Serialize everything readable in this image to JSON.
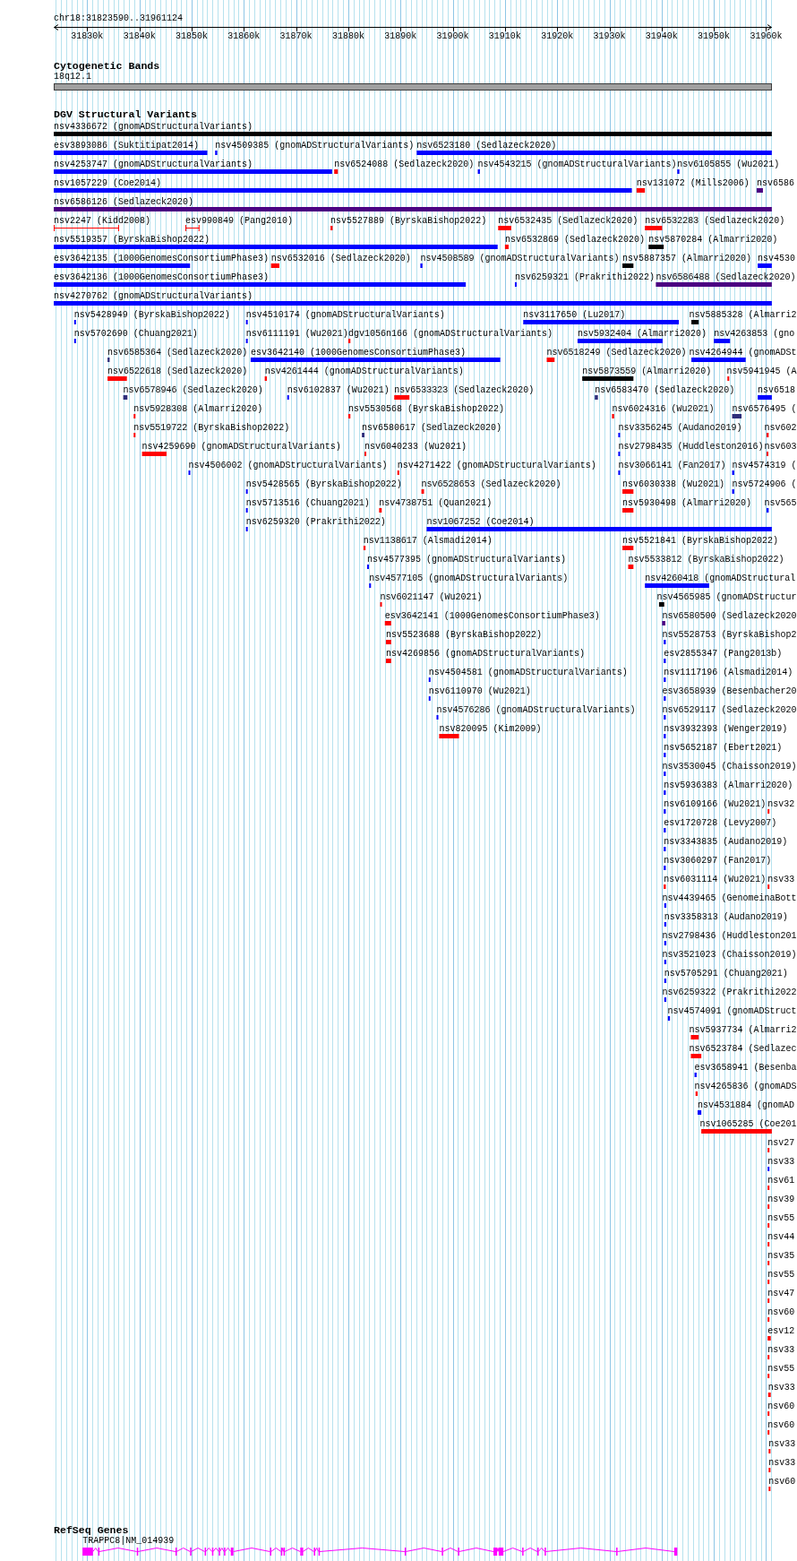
{
  "ruler": {
    "location": "chr18:31823590..31961124",
    "ticks": [
      "31830k",
      "31840k",
      "31850k",
      "31860k",
      "31870k",
      "31880k",
      "31890k",
      "31900k",
      "31910k",
      "31920k",
      "31930k",
      "31940k",
      "31950k",
      "31960k"
    ]
  },
  "cytogenetic_bands": {
    "title": "Cytogenetic Bands",
    "bands": [
      {
        "name": "18q12.1"
      }
    ]
  },
  "dgv_structural_variants": {
    "title": "DGV Structural Variants",
    "rows": [
      [
        {
          "label": "nsv4336672 (gnomADStructuralVariants)",
          "color": "#000000",
          "kind": "bar"
        }
      ],
      [
        {
          "label": "esv3893086 (Suktitipat2014)",
          "color": "#0000ff",
          "kind": "bar"
        },
        {
          "label": "nsv4509385 (gnomADStructuralVariants)",
          "color": "#0000ff",
          "kind": "bar"
        },
        {
          "label": "nsv6523180 (Sedlazeck2020)",
          "color": "#0000ff",
          "kind": "bar"
        }
      ],
      [
        {
          "label": "nsv4253747 (gnomADStructuralVariants)",
          "color": "#0000ff",
          "kind": "bar"
        },
        {
          "label": "nsv6524088 (Sedlazeck2020)",
          "color": "#ff0000",
          "kind": "bar"
        },
        {
          "label": "nsv4543215 (gnomADStructuralVariants)",
          "color": "#0000ff",
          "kind": "bar"
        },
        {
          "label": "nsv6105855 (Wu2021)",
          "color": "#0000ff",
          "kind": "bar"
        }
      ],
      [
        {
          "label": "nsv1057229 (Coe2014)",
          "color": "#0000ff",
          "kind": "bar"
        },
        {
          "label": "nsv131072 (Mills2006)",
          "color": "#ff0000",
          "kind": "bar"
        },
        {
          "label": "nsv6586",
          "color": "#4b0082",
          "kind": "bar"
        }
      ],
      [
        {
          "label": "nsv6586126 (Sedlazeck2020)",
          "color": "#4b0082",
          "kind": "bar"
        }
      ],
      [
        {
          "label": "nsv2247 (Kidd2008)",
          "color": "#ff0000",
          "kind": "span"
        },
        {
          "label": "esv990849 (Pang2010)",
          "color": "#ff0000",
          "kind": "span"
        },
        {
          "label": "nsv5527889 (ByrskaBishop2022)",
          "color": "#ff0000",
          "kind": "bar"
        },
        {
          "label": "nsv6532435 (Sedlazeck2020)",
          "color": "#ff0000",
          "kind": "bar"
        },
        {
          "label": "nsv6532283 (Sedlazeck2020)",
          "color": "#ff0000",
          "kind": "bar"
        }
      ],
      [
        {
          "label": "nsv5519357 (ByrskaBishop2022)",
          "color": "#0000ff",
          "kind": "bar"
        },
        {
          "label": "nsv6532869 (Sedlazeck2020)",
          "color": "#ff0000",
          "kind": "bar"
        },
        {
          "label": "nsv5870284 (Almarri2020)",
          "color": "#000000",
          "kind": "bar"
        }
      ],
      [
        {
          "label": "esv3642135 (1000GenomesConsortiumPhase3)",
          "color": "#0000ff",
          "kind": "bar"
        },
        {
          "label": "nsv6532016 (Sedlazeck2020)",
          "color": "#ff0000",
          "kind": "bar"
        },
        {
          "label": "nsv4508589 (gnomADStructuralVariants)",
          "color": "#0000ff",
          "kind": "bar"
        },
        {
          "label": "nsv5887357 (Almarri2020)",
          "color": "#000000",
          "kind": "bar"
        },
        {
          "label": "nsv4530",
          "color": "#0000ff",
          "kind": "bar"
        }
      ],
      [
        {
          "label": "esv3642136 (1000GenomesConsortiumPhase3)",
          "color": "#0000ff",
          "kind": "bar"
        },
        {
          "label": "nsv6259321 (Prakrithi2022)",
          "color": "#0000ff",
          "kind": "bar"
        },
        {
          "label": "nsv6586488 (Sedlazeck2020)",
          "color": "#4b0082",
          "kind": "bar"
        }
      ],
      [
        {
          "label": "nsv4270762 (gnomADStructuralVariants)",
          "color": "#0000ff",
          "kind": "bar"
        }
      ],
      [
        {
          "label": "nsv5428949 (ByrskaBishop2022)",
          "color": "#0000ff",
          "kind": "bar"
        },
        {
          "label": "nsv4510174 (gnomADStructuralVariants)",
          "color": "#0000ff",
          "kind": "bar"
        },
        {
          "label": "nsv3117650 (Lu2017)",
          "color": "#0000ff",
          "kind": "bar"
        },
        {
          "label": "nsv5885328 (Almarri2",
          "color": "#000000",
          "kind": "bar"
        }
      ],
      [
        {
          "label": "nsv5702690 (Chuang2021)",
          "color": "#0000ff",
          "kind": "bar"
        },
        {
          "label": "nsv6111191 (Wu2021)",
          "color": "#0000ff",
          "kind": "bar"
        },
        {
          "label": "dgv1056n166 (gnomADStructuralVariants)",
          "color": "#ff0000",
          "kind": "bar"
        },
        {
          "label": "nsv5932404 (Almarri2020)",
          "color": "#0000ff",
          "kind": "bar"
        },
        {
          "label": "nsv4263853 (gno",
          "color": "#0000ff",
          "kind": "bar"
        }
      ],
      [
        {
          "label": "nsv6585364 (Sedlazeck2020)",
          "color": "#2e2e7a",
          "kind": "bar"
        },
        {
          "label": "esv3642140 (1000GenomesConsortiumPhase3)",
          "color": "#0000ff",
          "kind": "bar"
        },
        {
          "label": "nsv6518249 (Sedlazeck2020)",
          "color": "#ff0000",
          "kind": "bar"
        },
        {
          "label": "nsv4264944 (gnomADSt",
          "color": "#0000ff",
          "kind": "bar"
        }
      ],
      [
        {
          "label": "nsv6522618 (Sedlazeck2020)",
          "color": "#ff0000",
          "kind": "bar"
        },
        {
          "label": "nsv4261444 (gnomADStructuralVariants)",
          "color": "#ff0000",
          "kind": "bar"
        },
        {
          "label": "nsv5873559 (Almarri2020)",
          "color": "#000000",
          "kind": "bar"
        },
        {
          "label": "nsv5941945 (A",
          "color": "#ff0000",
          "kind": "bar"
        }
      ],
      [
        {
          "label": "nsv6578946 (Sedlazeck2020)",
          "color": "#2e2e7a",
          "kind": "bar"
        },
        {
          "label": "nsv6102837 (Wu2021)",
          "color": "#0000ff",
          "kind": "bar"
        },
        {
          "label": "nsv6533323 (Sedlazeck2020)",
          "color": "#ff0000",
          "kind": "bar"
        },
        {
          "label": "nsv6583470 (Sedlazeck2020)",
          "color": "#2e2e7a",
          "kind": "bar"
        },
        {
          "label": "nsv6518",
          "color": "#0000ff",
          "kind": "bar"
        }
      ],
      [
        {
          "label": "nsv5928308 (Almarri2020)",
          "color": "#ff0000",
          "kind": "bar"
        },
        {
          "label": "nsv5530568 (ByrskaBishop2022)",
          "color": "#ff0000",
          "kind": "bar"
        },
        {
          "label": "nsv6024316 (Wu2021)",
          "color": "#ff0000",
          "kind": "bar"
        },
        {
          "label": "nsv6576495 (",
          "color": "#2e2e7a",
          "kind": "bar"
        }
      ],
      [
        {
          "label": "nsv5519722 (ByrskaBishop2022)",
          "color": "#ff0000",
          "kind": "bar"
        },
        {
          "label": "nsv6580617 (Sedlazeck2020)",
          "color": "#2e2e7a",
          "kind": "bar"
        },
        {
          "label": "nsv3356245 (Audano2019)",
          "color": "#0000ff",
          "kind": "bar"
        },
        {
          "label": "nsv602",
          "color": "#ff0000",
          "kind": "bar"
        }
      ],
      [
        {
          "label": "nsv4259690 (gnomADStructuralVariants)",
          "color": "#ff0000",
          "kind": "bar"
        },
        {
          "label": "nsv6040233 (Wu2021)",
          "color": "#ff0000",
          "kind": "bar"
        },
        {
          "label": "nsv2798435 (Huddleston2016)",
          "color": "#0000ff",
          "kind": "bar"
        },
        {
          "label": "nsv603",
          "color": "#ff0000",
          "kind": "bar"
        }
      ],
      [
        {
          "label": "nsv4506002 (gnomADStructuralVariants)",
          "color": "#0000ff",
          "kind": "bar"
        },
        {
          "label": "nsv4271422 (gnomADStructuralVariants)",
          "color": "#ff0000",
          "kind": "bar"
        },
        {
          "label": "nsv3066141 (Fan2017)",
          "color": "#0000ff",
          "kind": "bar"
        },
        {
          "label": "nsv4574319 (",
          "color": "#0000ff",
          "kind": "bar"
        }
      ],
      [
        {
          "label": "nsv5428565 (ByrskaBishop2022)",
          "color": "#0000ff",
          "kind": "bar"
        },
        {
          "label": "nsv6528653 (Sedlazeck2020)",
          "color": "#ff0000",
          "kind": "bar"
        },
        {
          "label": "nsv6030338 (Wu2021)",
          "color": "#ff0000",
          "kind": "bar"
        },
        {
          "label": "nsv5724906 (",
          "color": "#0000ff",
          "kind": "bar"
        }
      ],
      [
        {
          "label": "nsv5713516 (Chuang2021)",
          "color": "#0000ff",
          "kind": "bar"
        },
        {
          "label": "nsv4738751 (Quan2021)",
          "color": "#ff0000",
          "kind": "bar"
        },
        {
          "label": "nsv5930498 (Almarri2020)",
          "color": "#ff0000",
          "kind": "bar"
        },
        {
          "label": "nsv565",
          "color": "#0000ff",
          "kind": "bar"
        }
      ],
      [
        {
          "label": "nsv6259320 (Prakrithi2022)",
          "color": "#0000ff",
          "kind": "bar"
        },
        {
          "label": "nsv1067252 (Coe2014)",
          "color": "#0000ff",
          "kind": "bar"
        }
      ],
      [
        {
          "label": "nsv1138617 (Alsmadi2014)",
          "color": "#ff0000",
          "kind": "bar"
        },
        {
          "label": "nsv5521841 (ByrskaBishop2022)",
          "color": "#ff0000",
          "kind": "bar"
        }
      ],
      [
        {
          "label": "nsv4577395 (gnomADStructuralVariants)",
          "color": "#0000ff",
          "kind": "bar"
        },
        {
          "label": "nsv5533812 (ByrskaBishop2022)",
          "color": "#ff0000",
          "kind": "bar"
        }
      ],
      [
        {
          "label": "nsv4577105 (gnomADStructuralVariants)",
          "color": "#0000ff",
          "kind": "bar"
        },
        {
          "label": "nsv4260418 (gnomADStructural",
          "color": "#0000ff",
          "kind": "bar"
        }
      ],
      [
        {
          "label": "nsv6021147 (Wu2021)",
          "color": "#ff0000",
          "kind": "bar"
        },
        {
          "label": "nsv4565985 (gnomADStructur",
          "color": "#000000",
          "kind": "bar"
        }
      ],
      [
        {
          "label": "esv3642141 (1000GenomesConsortiumPhase3)",
          "color": "#ff0000",
          "kind": "bar"
        },
        {
          "label": "nsv6580500 (Sedlazeck2020",
          "color": "#4b0082",
          "kind": "bar"
        }
      ],
      [
        {
          "label": "nsv5523688 (ByrskaBishop2022)",
          "color": "#ff0000",
          "kind": "bar"
        },
        {
          "label": "nsv5528753 (ByrskaBishop2",
          "color": "#0000ff",
          "kind": "bar"
        }
      ],
      [
        {
          "label": "nsv4269856 (gnomADStructuralVariants)",
          "color": "#ff0000",
          "kind": "bar"
        },
        {
          "label": "esv2855347 (Pang2013b)",
          "color": "#0000ff",
          "kind": "bar"
        }
      ],
      [
        {
          "label": "nsv4504581 (gnomADStructuralVariants)",
          "color": "#0000ff",
          "kind": "bar"
        },
        {
          "label": "nsv1117196 (Alsmadi2014)",
          "color": "#0000ff",
          "kind": "bar"
        }
      ],
      [
        {
          "label": "nsv6110970 (Wu2021)",
          "color": "#0000ff",
          "kind": "bar"
        },
        {
          "label": "esv3658939 (Besenbacher20",
          "color": "#0000ff",
          "kind": "bar"
        }
      ],
      [
        {
          "label": "nsv4576286 (gnomADStructuralVariants)",
          "color": "#0000ff",
          "kind": "bar"
        },
        {
          "label": "nsv6529117 (Sedlazeck2020",
          "color": "#0000ff",
          "kind": "bar"
        }
      ],
      [
        {
          "label": "nsv820095 (Kim2009)",
          "color": "#ff0000",
          "kind": "bar"
        },
        {
          "label": "nsv3932393 (Wenger2019)",
          "color": "#0000ff",
          "kind": "bar"
        }
      ],
      [
        {
          "label": "nsv5652187 (Ebert2021)",
          "color": "#0000ff",
          "kind": "bar"
        }
      ],
      [
        {
          "label": "nsv3530045 (Chaisson2019)",
          "color": "#0000ff",
          "kind": "bar"
        }
      ],
      [
        {
          "label": "nsv5936383 (Almarri2020)",
          "color": "#0000ff",
          "kind": "bar"
        }
      ],
      [
        {
          "label": "nsv6109166 (Wu2021)",
          "color": "#0000ff",
          "kind": "bar"
        },
        {
          "label": "nsv32",
          "color": "#ff0000",
          "kind": "bar"
        }
      ],
      [
        {
          "label": "esv1720728 (Levy2007)",
          "color": "#0000ff",
          "kind": "bar"
        }
      ],
      [
        {
          "label": "nsv3343835 (Audano2019)",
          "color": "#0000ff",
          "kind": "bar"
        }
      ],
      [
        {
          "label": "nsv3060297 (Fan2017)",
          "color": "#0000ff",
          "kind": "bar"
        }
      ],
      [
        {
          "label": "nsv6031114 (Wu2021)",
          "color": "#ff0000",
          "kind": "bar"
        },
        {
          "label": "nsv33",
          "color": "#ff0000",
          "kind": "bar"
        }
      ],
      [
        {
          "label": "nsv4439465 (GenomeinaBott",
          "color": "#0000ff",
          "kind": "bar"
        }
      ],
      [
        {
          "label": "nsv3358313 (Audano2019)",
          "color": "#0000ff",
          "kind": "bar"
        }
      ],
      [
        {
          "label": "nsv2798436 (Huddleston201",
          "color": "#0000ff",
          "kind": "bar"
        }
      ],
      [
        {
          "label": "nsv3521023 (Chaisson2019)",
          "color": "#0000ff",
          "kind": "bar"
        }
      ],
      [
        {
          "label": "nsv5705291 (Chuang2021)",
          "color": "#0000ff",
          "kind": "bar"
        }
      ],
      [
        {
          "label": "nsv6259322 (Prakrithi2022",
          "color": "#0000ff",
          "kind": "bar"
        }
      ],
      [
        {
          "label": "nsv4574091 (gnomADStruct",
          "color": "#0000ff",
          "kind": "bar"
        }
      ],
      [
        {
          "label": "nsv5937734 (Almarri2",
          "color": "#ff0000",
          "kind": "bar"
        }
      ],
      [
        {
          "label": "nsv6523784 (Sedlazec",
          "color": "#ff0000",
          "kind": "bar"
        }
      ],
      [
        {
          "label": "esv3658941 (Besenba",
          "color": "#0000ff",
          "kind": "bar"
        }
      ],
      [
        {
          "label": "nsv4265836 (gnomADS",
          "color": "#ff0000",
          "kind": "bar"
        }
      ],
      [
        {
          "label": "nsv4531884 (gnomAD",
          "color": "#0000ff",
          "kind": "bar"
        }
      ],
      [
        {
          "label": "nsv1065285 (Coe201",
          "color": "#ff0000",
          "kind": "bar"
        }
      ],
      [
        {
          "label": "nsv27",
          "color": "#ff0000",
          "kind": "bar"
        }
      ],
      [
        {
          "label": "nsv33",
          "color": "#0000ff",
          "kind": "bar"
        }
      ],
      [
        {
          "label": "nsv61",
          "color": "#ff0000",
          "kind": "bar"
        }
      ],
      [
        {
          "label": "nsv39",
          "color": "#ff0000",
          "kind": "bar"
        }
      ],
      [
        {
          "label": "nsv55",
          "color": "#ff0000",
          "kind": "bar"
        }
      ],
      [
        {
          "label": "nsv44",
          "color": "#ff0000",
          "kind": "bar"
        }
      ],
      [
        {
          "label": "nsv35",
          "color": "#ff0000",
          "kind": "bar"
        }
      ],
      [
        {
          "label": "nsv55",
          "color": "#ff0000",
          "kind": "bar"
        }
      ],
      [
        {
          "label": "nsv47",
          "color": "#ff0000",
          "kind": "bar"
        }
      ],
      [
        {
          "label": "nsv60",
          "color": "#ff0000",
          "kind": "bar"
        }
      ],
      [
        {
          "label": "esv12",
          "color": "#ff0000",
          "kind": "bar"
        }
      ],
      [
        {
          "label": "nsv33",
          "color": "#ff0000",
          "kind": "bar"
        }
      ],
      [
        {
          "label": "nsv55",
          "color": "#ff0000",
          "kind": "bar"
        }
      ],
      [
        {
          "label": "nsv33",
          "color": "#ff0000",
          "kind": "bar"
        }
      ],
      [
        {
          "label": "nsv60",
          "color": "#ff0000",
          "kind": "bar"
        }
      ],
      [
        {
          "label": "nsv60",
          "color": "#ff0000",
          "kind": "bar"
        }
      ],
      [
        {
          "label": "nsv33",
          "color": "#ff0000",
          "kind": "bar"
        }
      ],
      [
        {
          "label": "nsv33",
          "color": "#ff0000",
          "kind": "bar"
        }
      ],
      [
        {
          "label": "nsv60",
          "color": "#ff0000",
          "kind": "bar"
        }
      ]
    ]
  },
  "refseq_genes": {
    "title": "RefSeq Genes",
    "genes": [
      {
        "label": "TRAPPC8|NM_014939"
      }
    ]
  }
}
